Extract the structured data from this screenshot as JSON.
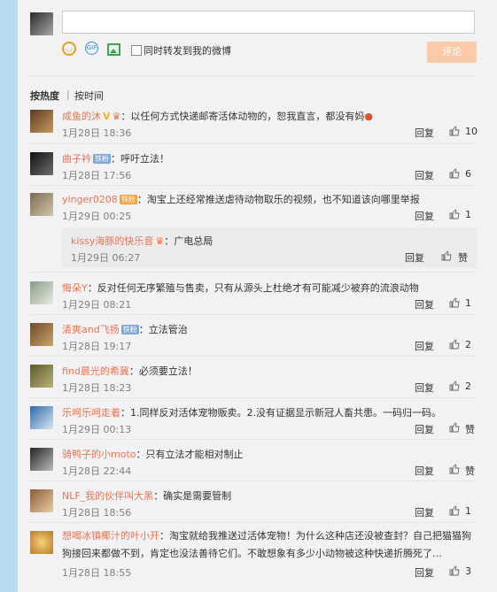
{
  "composer": {
    "submit_label": "评论",
    "repost_label": "同时转发到我的微博",
    "gif_label": "GIF"
  },
  "sort": {
    "hot_label": "按热度",
    "time_label": "按时间"
  },
  "colors": {
    "username": "#eb7350",
    "submit_bg": "#fccaa8",
    "background": "#bfe0f4"
  },
  "comments": [
    {
      "user": "咸鱼的沐",
      "text": "：以任何方式快递邮寄活体动物的，恕我直言，都没有妈",
      "date": "1月28日 18:36",
      "reply": "回复",
      "likes": "10"
    },
    {
      "user": "曲子衿",
      "badge": "铁粉",
      "text": "：呼吁立法！",
      "date": "1月28日 17:56",
      "reply": "回复",
      "likes": "6"
    },
    {
      "user": "yinger0208",
      "badge": "铁粉",
      "text": "：淘宝上还经常推送虐待动物取乐的视频，也不知道该向哪里举报",
      "date": "1月29日 00:25",
      "reply": "回复",
      "likes": "1"
    },
    {
      "user": "kissy海豚的快乐音",
      "text": "：广电总局",
      "date": "1月29日 06:27",
      "reply": "回复",
      "likes": "赞"
    },
    {
      "user": "悔朵Y",
      "text": "：反对任何无序繁殖与售卖，只有从源头上杜绝才有可能减少被弃的流浪动物",
      "date": "1月29日 08:21",
      "reply": "回复",
      "likes": "1"
    },
    {
      "user": "清爽and飞扬",
      "badge": "铁粉",
      "text": "：立法管治",
      "date": "1月28日 19:17",
      "reply": "回复",
      "likes": "2"
    },
    {
      "user": "find晨光的希冀",
      "text": "：必须要立法！",
      "date": "1月28日 18:23",
      "reply": "回复",
      "likes": "2"
    },
    {
      "user": "乐呵乐呵走着",
      "text": "：1.同样反对活体宠物贩卖。2.没有证据显示新冠人畜共患。一码归一码。",
      "date": "1月29日 00:13",
      "reply": "回复",
      "likes": "赞"
    },
    {
      "user": "骑鸭子的小moto",
      "text": "：只有立法才能相对制止",
      "date": "1月28日 22:44",
      "reply": "回复",
      "likes": "赞"
    },
    {
      "user": "NLF_我的伙伴叫大黑",
      "text": "：确实是需要管制",
      "date": "1月28日 18:56",
      "reply": "回复",
      "likes": "1"
    },
    {
      "user": "想喝冰镇椰汁的叶小开",
      "text": "：淘宝就给我推送过活体宠物！为什么这种店还没被查封？自己把猫猫狗狗接回来都做不到，肯定也没法善待它们。不敢想象有多少小动物被这种快递折腾死了…",
      "date": "1月28日 18:55",
      "reply": "回复",
      "likes": "3"
    }
  ]
}
